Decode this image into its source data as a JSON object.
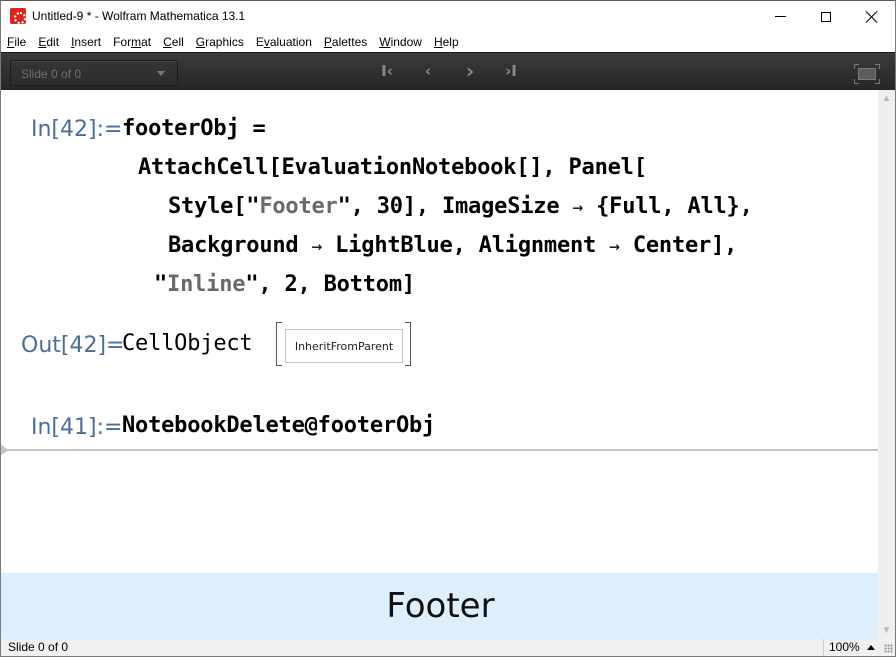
{
  "window": {
    "title": "Untitled-9 * - Wolfram Mathematica 13.1",
    "icon": "wolfram-spikey-icon"
  },
  "menu": [
    {
      "label": "File",
      "mnemonic": "F",
      "rest": "ile"
    },
    {
      "label": "Edit",
      "mnemonic": "E",
      "rest": "dit"
    },
    {
      "label": "Insert",
      "mnemonic": "I",
      "rest": "nsert"
    },
    {
      "label": "Format",
      "pre": "For",
      "mnemonic": "m",
      "rest": "at"
    },
    {
      "label": "Cell",
      "mnemonic": "C",
      "rest": "ell"
    },
    {
      "label": "Graphics",
      "mnemonic": "G",
      "rest": "raphics"
    },
    {
      "label": "Evaluation",
      "pre": "E",
      "mnemonic": "v",
      "rest": "aluation"
    },
    {
      "label": "Palettes",
      "mnemonic": "P",
      "rest": "alettes"
    },
    {
      "label": "Window",
      "mnemonic": "W",
      "rest": "indow"
    },
    {
      "label": "Help",
      "mnemonic": "H",
      "rest": "elp"
    }
  ],
  "toolbar": {
    "slide_selector": "Slide 0 of 0",
    "nav_first": "K",
    "nav_prev": "‹",
    "nav_next": "›",
    "nav_last": "›I"
  },
  "cells": {
    "in42_label": "In[42]:=",
    "in42_lines": [
      "footerObj =",
      "AttachCell[EvaluationNotebook[], Panel[",
      "Style[\"Footer\", 30], ImageSize → {Full, All},",
      "Background → LightBlue, Alignment → Center],",
      "\"Inline\", 2, Bottom]"
    ],
    "out42_label": "Out[42]=",
    "out42_head": "CellObject",
    "out42_box": "InheritFromParent",
    "in41_label": "In[41]:=",
    "in41_code": "NotebookDelete@footerObj"
  },
  "footer": {
    "text": "Footer",
    "background": "#ddeefc"
  },
  "statusbar": {
    "slide": "Slide 0 of 0",
    "zoom": "100%"
  }
}
